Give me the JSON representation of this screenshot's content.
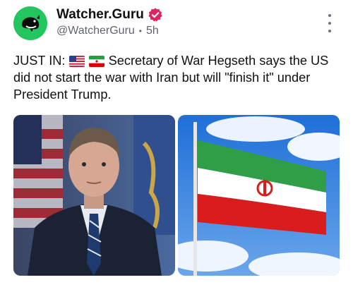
{
  "account": {
    "display_name": "Watcher.Guru",
    "handle": "@WatcherGuru",
    "separator": "•",
    "time": "5h",
    "avatar_icon": "whale-icon",
    "verified_icon": "verified-badge-icon",
    "brand_color": "#22c55e",
    "badge_color": "#e0245e"
  },
  "post": {
    "prefix": "JUST IN:",
    "flags": [
      "us-flag-icon",
      "iran-flag-icon"
    ],
    "text": "Secretary of War Hegseth says the US did not start the war with Iran but will \"finish it\" under President Trump."
  },
  "media": [
    {
      "icon": "portrait-photo"
    },
    {
      "icon": "iran-flag-photo"
    }
  ],
  "more_icon": "more-options-icon"
}
